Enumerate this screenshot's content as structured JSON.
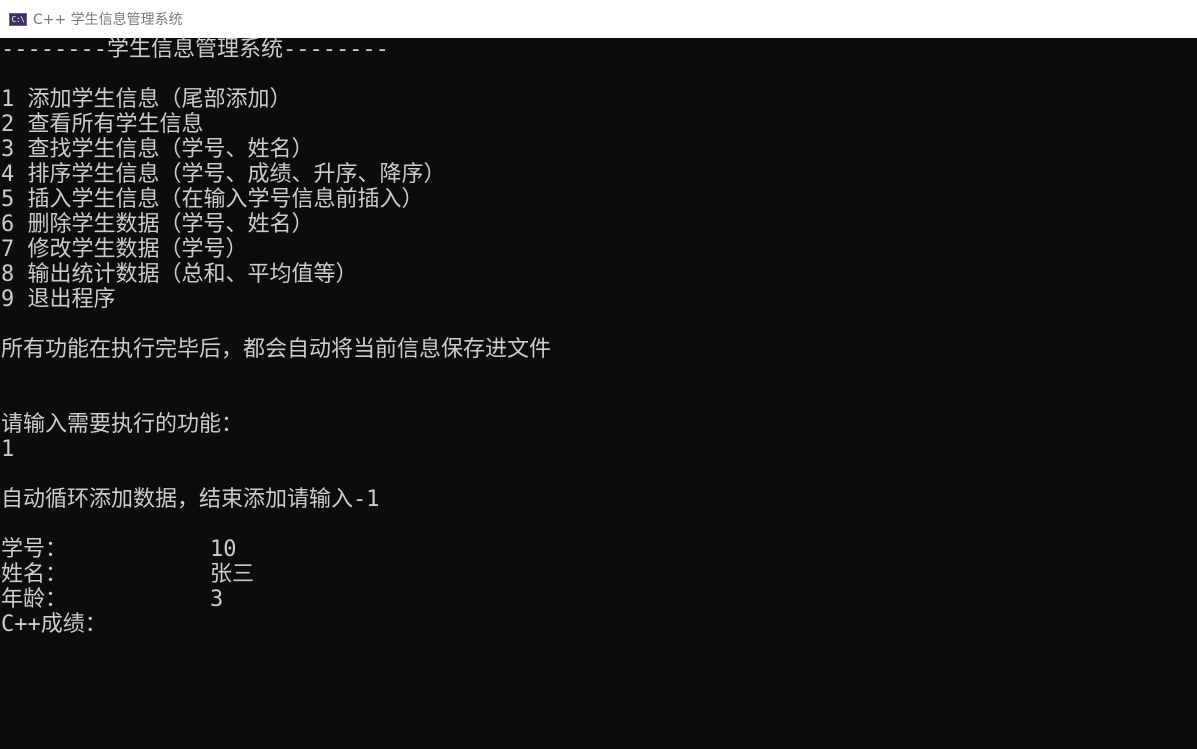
{
  "window": {
    "icon_text": "C:\\",
    "title": "C++ 学生信息管理系统"
  },
  "console": {
    "header": "--------学生信息管理系统--------",
    "menu": [
      "1 添加学生信息（尾部添加）",
      "2 查看所有学生信息",
      "3 查找学生信息（学号、姓名）",
      "4 排序学生信息（学号、成绩、升序、降序）",
      "5 插入学生信息（在输入学号信息前插入）",
      "6 删除学生数据（学号、姓名）",
      "7 修改学生数据（学号）",
      "8 输出统计数据（总和、平均值等）",
      "9 退出程序"
    ],
    "note": "所有功能在执行完毕后，都会自动将当前信息保存进文件",
    "prompt": "请输入需要执行的功能：",
    "user_choice": "1",
    "loop_message": "自动循环添加数据，结束添加请输入-1",
    "fields": [
      {
        "label": "学号：",
        "value": "10"
      },
      {
        "label": "姓名：",
        "value": "张三"
      },
      {
        "label": "年龄：",
        "value": "3"
      },
      {
        "label": "C++成绩：",
        "value": ""
      }
    ]
  }
}
